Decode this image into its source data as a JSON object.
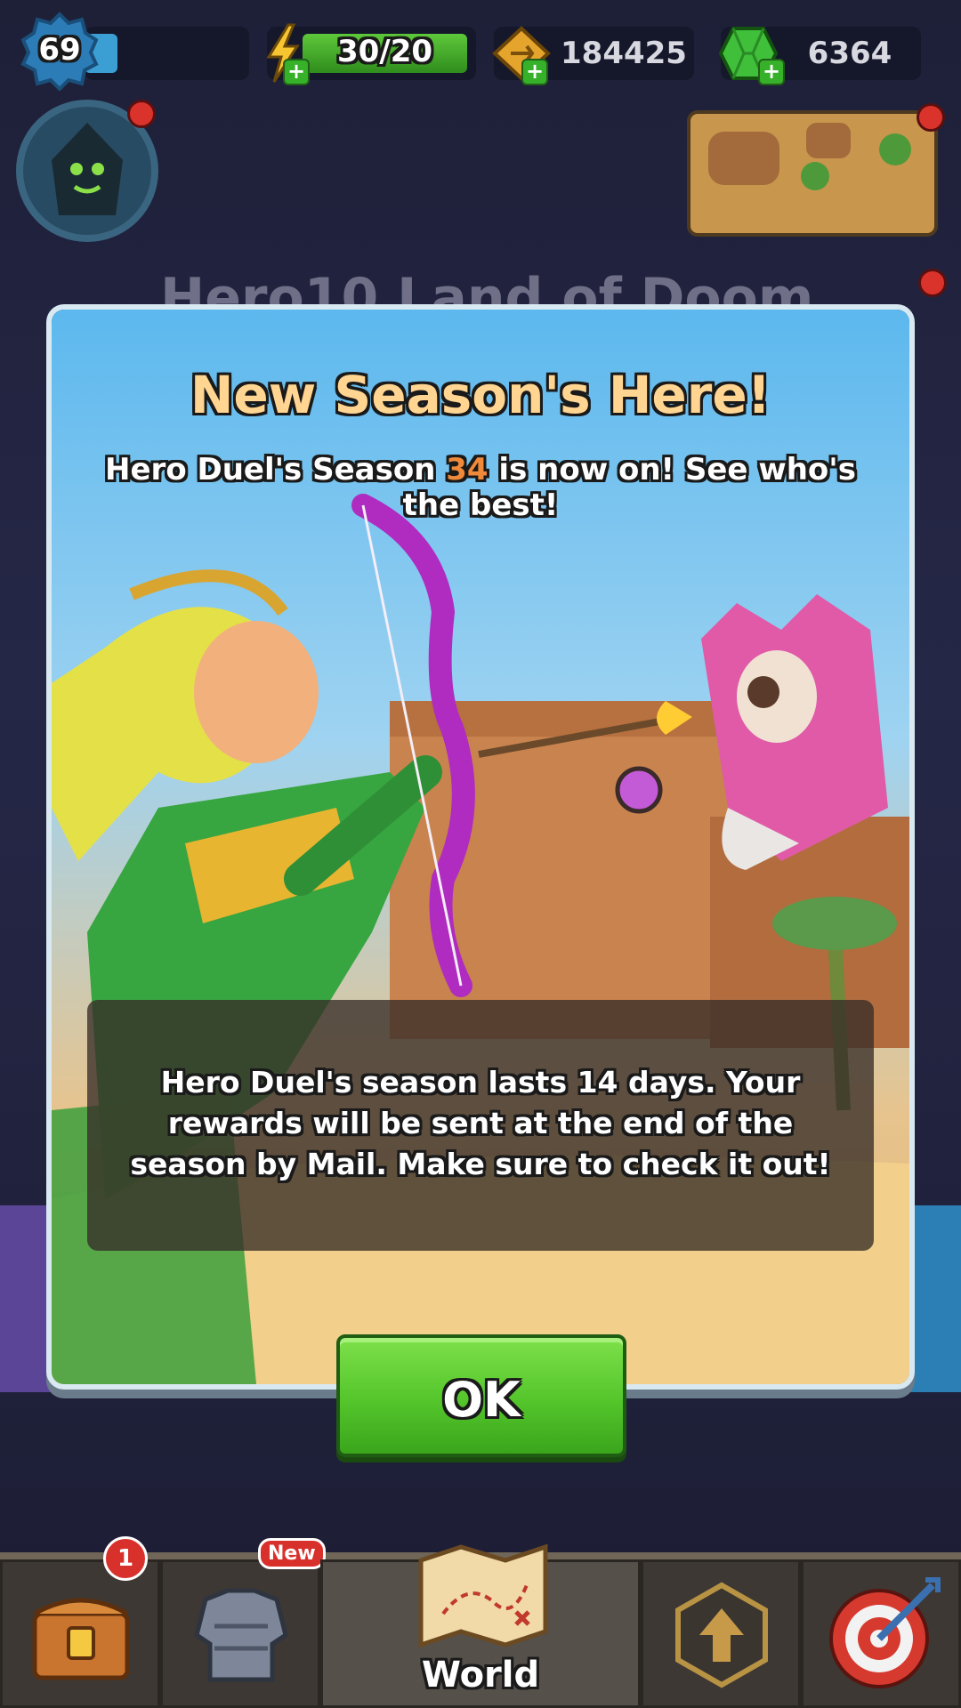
{
  "hud": {
    "level": "69",
    "xp_progress": 0.2,
    "energy": "30/20",
    "gold": "184425",
    "gems": "6364",
    "plus_symbol": "+"
  },
  "background": {
    "title_fragment": "Hero10 Land of Doom"
  },
  "modal": {
    "title": "New Season's Here!",
    "subtitle_before": "Hero Duel's Season ",
    "season_number": "34",
    "subtitle_after": " is now on! See who's the best!",
    "info": "Hero Duel's season lasts 14 days. Your rewards will be sent at the end of the season by Mail. Make sure to check it out!",
    "ok_label": "OK"
  },
  "nav": {
    "chest_badge": "1",
    "armor_badge": "New",
    "world_label": "World"
  },
  "colors": {
    "accent_orange": "#f08a3a",
    "title_gold": "#ffd591",
    "ok_green": "#54c52b"
  }
}
